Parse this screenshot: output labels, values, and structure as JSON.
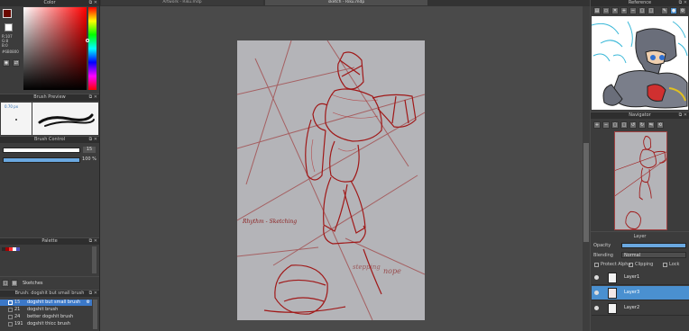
{
  "color_panel": {
    "title": "Color",
    "rgb_readout": "R:107\nG:8\nB:0",
    "hex": "#6B0800"
  },
  "brush_preview": {
    "title": "Brush Preview",
    "size": "0.70 px"
  },
  "brush_control": {
    "title": "Brush Control",
    "size_value": "15",
    "opacity_value": "100 %"
  },
  "palette": {
    "title": "Palette",
    "swatches": [
      "#2a2a2a",
      "#a00000",
      "#ff3030",
      "#ffffff",
      "#5050c0"
    ]
  },
  "layer_folder": {
    "label": "Sketches"
  },
  "brush_list": {
    "title": "Brush: dogshit but small brush",
    "items": [
      {
        "size": "15",
        "name": "dogshit but small brush",
        "selected": true
      },
      {
        "size": "21",
        "name": "dogshit brush",
        "selected": false
      },
      {
        "size": "24",
        "name": "better dogshit brush",
        "selected": false
      },
      {
        "size": "191",
        "name": "dogshit thicc brush",
        "selected": false
      }
    ]
  },
  "tabs": [
    {
      "label": "Artwork - Riku.mdp",
      "active": false
    },
    {
      "label": "sketch - Riku.mdp",
      "active": true
    }
  ],
  "canvas": {
    "signature": "Rhythm - Sketching",
    "annotation": "nope",
    "annotation2": "stepping"
  },
  "reference": {
    "title": "Reference"
  },
  "navigator": {
    "title": "Navigator"
  },
  "layer_panel": {
    "title": "Layer",
    "opacity_label": "Opacity",
    "blending_label": "Blending",
    "blending_value": "Normal",
    "protect_alpha": "Protect Alpha",
    "clipping": "Clipping",
    "lock": "Lock",
    "layers": [
      {
        "name": "Layer1",
        "selected": false
      },
      {
        "name": "Layer3",
        "selected": true
      },
      {
        "name": "Layer2",
        "selected": false
      }
    ]
  },
  "colors": {
    "accent": "#4a90d0",
    "sketch": "#a01818",
    "canvas": "#b4b4b8"
  }
}
